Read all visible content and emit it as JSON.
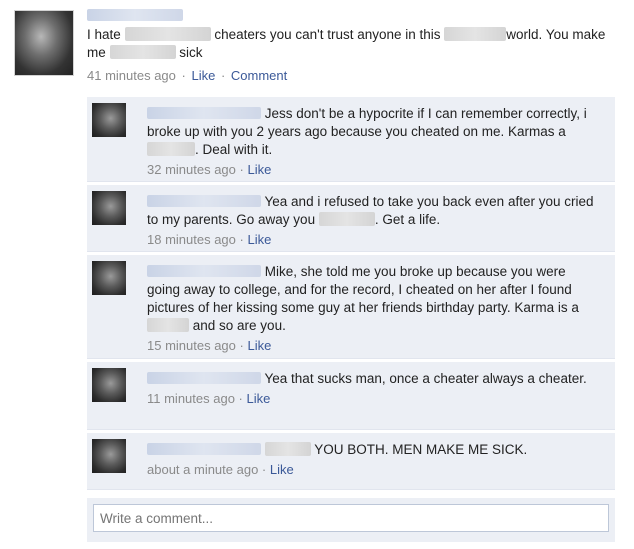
{
  "post": {
    "text_1": "I hate",
    "text_2": "cheaters you can't trust anyone in this",
    "text_3": "world. You make me",
    "text_4": "sick",
    "time": "41 minutes ago",
    "like_label": "Like",
    "comment_label": "Comment"
  },
  "comments": [
    {
      "text_1": "Jess don't be a hypocrite if I can remember correctly, i broke up with you 2 years ago because you cheated on me. Karmas a",
      "text_2": ". Deal with it.",
      "time": "32 minutes ago",
      "like_label": "Like"
    },
    {
      "text_1": "Yea and i refused to take you back even after you cried to my parents. Go away you",
      "text_2": ". Get a life.",
      "time": "18 minutes ago",
      "like_label": "Like"
    },
    {
      "text_1": "Mike, she told me you broke up because you were going away to college, and for the record, I cheated on her after I found pictures of her kissing some guy at her friends birthday party. Karma is a",
      "text_2": "and so are you.",
      "time": "15 minutes ago",
      "like_label": "Like"
    },
    {
      "text_1": "Yea that sucks man, once a cheater always a cheater.",
      "time": "11 minutes ago",
      "like_label": "Like"
    },
    {
      "text_1": "YOU BOTH. MEN MAKE ME SICK.",
      "time": "about a minute ago",
      "like_label": "Like"
    }
  ],
  "write_comment": {
    "placeholder": "Write a comment..."
  },
  "colors": {
    "link": "#3b5998",
    "comment_bg": "#eceff5",
    "meta": "#8a8a8a"
  }
}
